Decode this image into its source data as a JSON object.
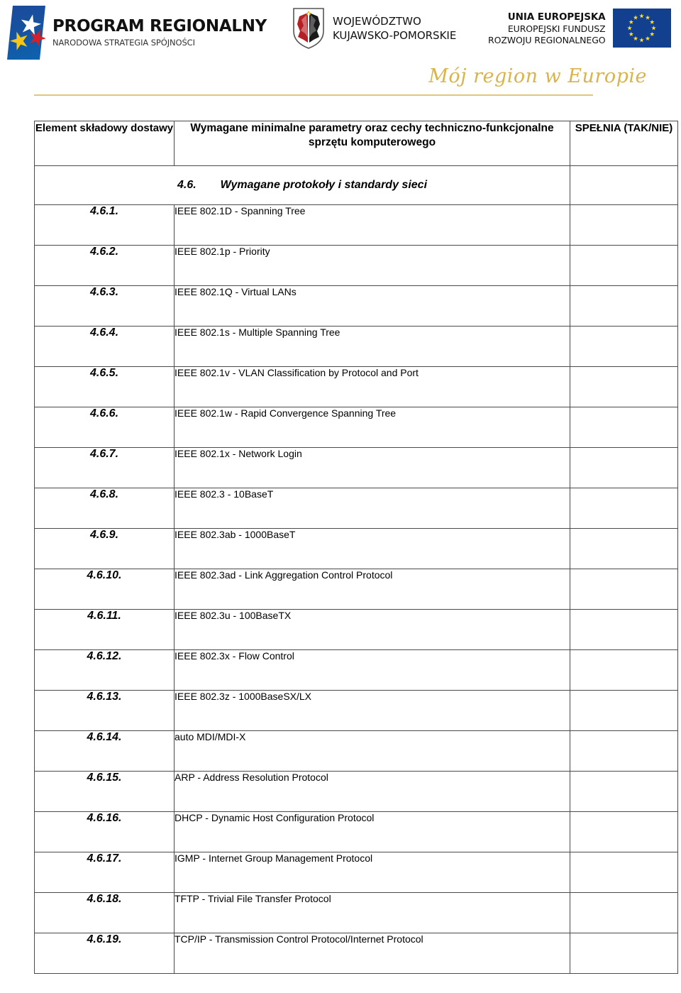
{
  "banner": {
    "program_logo": {
      "title": "PROGRAM REGIONALNY",
      "subtitle": "NARODOWA STRATEGIA SPÓJNOŚCI"
    },
    "voivodeship_logo": {
      "line1": "WOJEWÓDZTWO",
      "line2": "KUJAWSKO-POMORSKIE"
    },
    "eu_logo": {
      "line1": "UNIA EUROPEJSKA",
      "line2": "EUROPEJSKI FUNDUSZ",
      "line3": "ROZWOJU REGIONALNEGO"
    },
    "tagline": "Mój region w Europie",
    "colors": {
      "program_blue": "#16539f",
      "star_white": "#ffffff",
      "star_yellow": "#f5c518",
      "star_red": "#d81e26",
      "eu_blue": "#12408f",
      "eu_star_yellow": "#ffe12a",
      "gold_rule": "#e0c87a",
      "tagline_gold": "#d9b44a",
      "shield_red": "#b52025",
      "shield_black": "#1a1a1a"
    }
  },
  "table": {
    "headers": {
      "col1": "Element składowy dostawy",
      "col2": "Wymagane minimalne parametry oraz cechy techniczno-funkcjonalne sprzętu komputerowego",
      "col3": "SPEŁNIA (TAK/NIE)"
    },
    "section": {
      "number": "4.6.",
      "title": "Wymagane protokoły i standardy sieci"
    },
    "rows": [
      {
        "number": "4.6.1.",
        "description": "IEEE 802.1D - Spanning Tree",
        "compliance": ""
      },
      {
        "number": "4.6.2.",
        "description": "IEEE 802.1p - Priority",
        "compliance": ""
      },
      {
        "number": "4.6.3.",
        "description": "IEEE 802.1Q - Virtual LANs",
        "compliance": ""
      },
      {
        "number": "4.6.4.",
        "description": "IEEE 802.1s - Multiple Spanning Tree",
        "compliance": ""
      },
      {
        "number": "4.6.5.",
        "description": "IEEE 802.1v - VLAN Classification by Protocol and Port",
        "compliance": ""
      },
      {
        "number": "4.6.6.",
        "description": "IEEE 802.1w - Rapid Convergence Spanning Tree",
        "compliance": ""
      },
      {
        "number": "4.6.7.",
        "description": "IEEE 802.1x - Network Login",
        "compliance": ""
      },
      {
        "number": "4.6.8.",
        "description": "IEEE 802.3 - 10BaseT",
        "compliance": ""
      },
      {
        "number": "4.6.9.",
        "description": "IEEE 802.3ab - 1000BaseT",
        "compliance": ""
      },
      {
        "number": "4.6.10.",
        "description": "IEEE 802.3ad - Link Aggregation Control Protocol",
        "compliance": ""
      },
      {
        "number": "4.6.11.",
        "description": "IEEE 802.3u - 100BaseTX",
        "compliance": ""
      },
      {
        "number": "4.6.12.",
        "description": "IEEE 802.3x - Flow Control",
        "compliance": ""
      },
      {
        "number": "4.6.13.",
        "description": "IEEE 802.3z - 1000BaseSX/LX",
        "compliance": ""
      },
      {
        "number": "4.6.14.",
        "description": "auto MDI/MDI-X",
        "compliance": ""
      },
      {
        "number": "4.6.15.",
        "description": "ARP - Address Resolution Protocol",
        "compliance": ""
      },
      {
        "number": "4.6.16.",
        "description": "DHCP - Dynamic Host Configuration Protocol",
        "compliance": ""
      },
      {
        "number": "4.6.17.",
        "description": "IGMP - Internet Group Management Protocol",
        "compliance": ""
      },
      {
        "number": "4.6.18.",
        "description": "TFTP - Trivial File Transfer Protocol",
        "compliance": ""
      },
      {
        "number": "4.6.19.",
        "description": "TCP/IP - Transmission Control Protocol/Internet Protocol",
        "compliance": ""
      }
    ]
  }
}
